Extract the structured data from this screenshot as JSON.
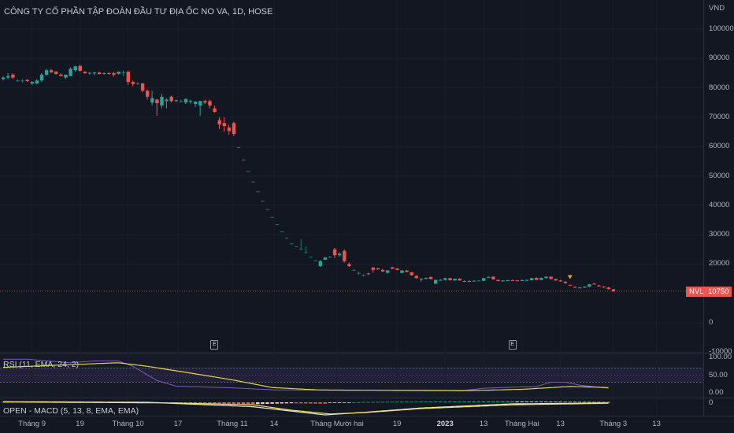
{
  "header": {
    "title": "CÔNG TY CỔ PHẦN TẬP ĐOÀN ĐẦU TƯ ĐỊA ỐC NO VA, 1D, HOSE",
    "currency": "VND"
  },
  "colors": {
    "up": "#26a69a",
    "down": "#ef5350",
    "background": "#131722",
    "rsi": "#7e57c2",
    "rsi_ema": "#e0d34a",
    "macd": "#e6e6e6",
    "signal": "#f5e15a",
    "marker": "#f7a21b"
  },
  "price_axis": {
    "ticks": [
      "100000",
      "90000",
      "80000",
      "70000",
      "60000",
      "50000",
      "40000",
      "30000",
      "20000",
      "0",
      "-10000"
    ],
    "tick_values": [
      100000,
      90000,
      80000,
      70000,
      60000,
      50000,
      40000,
      30000,
      20000,
      0,
      -10000
    ]
  },
  "last_price": {
    "symbol": "NVL",
    "value": "10750",
    "numeric": 10750
  },
  "earnings_markers": [
    {
      "label": "E",
      "bar": 44
    },
    {
      "label": "E",
      "bar": 106
    }
  ],
  "signal_marker": {
    "type": "triangle-down",
    "bar": 118
  },
  "chart_data": {
    "type": "candlestick",
    "unit": "thousand VND",
    "ylim": [
      -10000,
      105000
    ],
    "ohlc": [
      [
        83,
        84,
        82.5,
        83.5
      ],
      [
        83.5,
        85,
        83,
        84
      ],
      [
        84.5,
        85,
        83,
        83.5
      ],
      [
        82.5,
        83,
        82,
        82.5
      ],
      [
        82.5,
        83,
        81.8,
        82.5
      ],
      [
        82.7,
        83,
        82,
        82.3
      ],
      [
        81.5,
        82.3,
        81,
        82
      ],
      [
        81.5,
        83,
        81.3,
        82.5
      ],
      [
        82.5,
        85,
        82,
        84.5
      ],
      [
        84.5,
        86.5,
        84,
        86
      ],
      [
        86,
        86.5,
        85,
        85.3
      ],
      [
        85.5,
        85.8,
        84.5,
        84.7
      ],
      [
        84.5,
        85,
        84,
        84
      ],
      [
        83.5,
        84.5,
        83,
        84.5
      ],
      [
        84,
        87,
        84,
        86.5
      ],
      [
        86,
        87.5,
        85.5,
        87.3
      ],
      [
        87.5,
        87.8,
        85.5,
        85.8
      ],
      [
        85.5,
        85.7,
        84.8,
        85
      ],
      [
        85,
        85.3,
        84.5,
        85.1
      ],
      [
        85,
        85.5,
        84.3,
        85.2
      ],
      [
        85.2,
        85.6,
        84.6,
        84.7
      ],
      [
        84.8,
        85.3,
        84.5,
        85
      ],
      [
        85,
        85.5,
        84.5,
        84.8
      ],
      [
        85,
        85.5,
        83.8,
        84.5
      ],
      [
        84.8,
        85.6,
        84.5,
        85.5
      ],
      [
        85.2,
        86,
        84,
        85.2
      ],
      [
        85.5,
        85.8,
        81,
        82
      ],
      [
        82,
        82.5,
        80.5,
        81.3
      ],
      [
        81.5,
        82,
        81,
        81.5
      ],
      [
        81.5,
        81.7,
        78.5,
        79
      ],
      [
        79,
        79.5,
        76,
        77
      ],
      [
        75,
        79,
        74,
        76.5
      ],
      [
        76,
        76.3,
        70.5,
        74.8
      ],
      [
        74,
        78,
        73,
        77
      ],
      [
        75.5,
        76.5,
        73,
        76
      ],
      [
        77,
        77.3,
        75,
        75.5
      ],
      [
        75.5,
        76,
        75.2,
        75.8
      ],
      [
        75.5,
        76,
        75,
        75.5
      ],
      [
        75,
        76.4,
        74.5,
        76.2
      ],
      [
        75.5,
        76,
        74.5,
        75.6
      ],
      [
        74.5,
        75.5,
        73.5,
        75.3
      ],
      [
        74,
        75.6,
        70.5,
        75.5
      ],
      [
        75.5,
        76,
        74.5,
        75
      ],
      [
        75.5,
        76,
        73,
        74
      ],
      [
        73,
        74,
        71.5,
        71.8
      ],
      [
        69,
        70,
        66,
        67.5
      ],
      [
        68,
        70,
        65,
        67
      ],
      [
        66.5,
        67.5,
        64,
        65.3
      ],
      [
        68,
        68.5,
        63.5,
        64.3
      ],
      [
        59.8,
        59.8,
        59.8,
        59.8
      ],
      [
        55.6,
        55.6,
        55.6,
        55.6
      ],
      [
        51.7,
        51.7,
        51.7,
        51.7
      ],
      [
        48.1,
        48.1,
        48.1,
        48.1
      ],
      [
        44.7,
        44.7,
        44.7,
        44.7
      ],
      [
        41.6,
        41.6,
        41.6,
        41.6
      ],
      [
        38.7,
        38.7,
        38.7,
        38.7
      ],
      [
        36,
        36,
        36,
        36
      ],
      [
        33.5,
        33.5,
        33.5,
        33.5
      ],
      [
        31.1,
        31.1,
        31.1,
        31.1
      ],
      [
        29,
        29,
        29,
        29
      ],
      [
        27,
        27,
        27,
        27
      ],
      [
        26,
        26,
        26,
        26
      ],
      [
        25.2,
        28.5,
        25.2,
        25.2
      ],
      [
        24,
        26,
        24,
        24
      ],
      [
        22.5,
        22.5,
        22.5,
        22.5
      ],
      [
        21.3,
        21.3,
        21.3,
        21.3
      ],
      [
        19.3,
        21.3,
        19,
        21
      ],
      [
        21.5,
        22.5,
        21.3,
        22.2
      ],
      [
        22.5,
        22.8,
        22,
        22.5
      ],
      [
        25,
        25.5,
        22,
        23
      ],
      [
        23,
        24,
        22.5,
        23.5
      ],
      [
        24.5,
        25,
        20.5,
        21
      ],
      [
        20,
        20.5,
        19,
        19.3
      ],
      [
        18,
        18.3,
        17.8,
        18
      ],
      [
        17,
        17.5,
        16.3,
        17
      ],
      [
        16.3,
        16.5,
        15.8,
        16.3
      ],
      [
        16.8,
        17,
        16.3,
        16.6
      ],
      [
        18.8,
        19,
        17,
        18
      ],
      [
        18.5,
        18.8,
        18,
        18.2
      ],
      [
        18,
        18.3,
        17.3,
        17.5
      ],
      [
        17,
        18,
        16.8,
        17.8
      ],
      [
        18.9,
        19,
        18.3,
        18.4
      ],
      [
        18.5,
        18.6,
        17.9,
        18
      ],
      [
        17,
        17.9,
        16.9,
        17.8
      ],
      [
        17.8,
        18,
        17.2,
        17.3
      ],
      [
        17.2,
        17.3,
        16.1,
        16.2
      ],
      [
        16,
        16.2,
        15.1,
        15.2
      ],
      [
        14.8,
        15.2,
        14,
        15
      ],
      [
        15,
        15.4,
        14.8,
        15.3
      ],
      [
        15.6,
        15.7,
        14.8,
        14.9
      ],
      [
        13.3,
        14.7,
        13.2,
        14.6
      ],
      [
        14.5,
        14.9,
        14.3,
        14.6
      ],
      [
        14.6,
        15.3,
        14.4,
        15.2
      ],
      [
        15.2,
        15.3,
        14.4,
        14.5
      ],
      [
        14.4,
        15.1,
        14.3,
        15
      ],
      [
        15,
        15.2,
        14.3,
        14.4
      ],
      [
        14.2,
        14.4,
        13.9,
        14
      ],
      [
        14.1,
        14.5,
        13.9,
        14.2
      ],
      [
        14.2,
        14.5,
        14.1,
        14.3
      ],
      [
        14.4,
        14.6,
        14.2,
        14.4
      ],
      [
        14.3,
        15.3,
        14.2,
        15.2
      ],
      [
        15.4,
        15.8,
        15.3,
        15.6
      ],
      [
        15.7,
        15.8,
        14.7,
        14.8
      ],
      [
        14.6,
        14.8,
        14.1,
        14.2
      ],
      [
        14.1,
        14.5,
        14,
        14.4
      ],
      [
        14.4,
        14.6,
        14.3,
        14.5
      ],
      [
        14.5,
        14.7,
        14.3,
        14.4
      ],
      [
        14.4,
        14.6,
        14.2,
        14.3
      ],
      [
        14.4,
        14.8,
        14.2,
        14.5
      ],
      [
        14.4,
        14.7,
        14.2,
        14.6
      ],
      [
        14.5,
        15.3,
        14.4,
        15.2
      ],
      [
        15.3,
        15.5,
        14.5,
        14.6
      ],
      [
        14.6,
        15.4,
        14.5,
        15.3
      ],
      [
        15.2,
        15.8,
        15.1,
        15.7
      ],
      [
        15.7,
        15.8,
        14.8,
        14.9
      ],
      [
        14.9,
        15,
        14.3,
        14.4
      ],
      [
        14.4,
        14.6,
        14,
        14.1
      ],
      [
        14,
        14.1,
        13.4,
        13.5
      ],
      [
        12.9,
        13,
        12.6,
        12.8
      ],
      [
        12.2,
        12.4,
        11.9,
        12.1
      ],
      [
        11.9,
        12.2,
        11.8,
        12
      ],
      [
        12,
        12.4,
        11.9,
        12.3
      ],
      [
        12.3,
        13.2,
        12.2,
        13.1
      ],
      [
        13.3,
        13.6,
        13,
        13.1
      ],
      [
        12.7,
        12.9,
        12.3,
        12.4
      ],
      [
        12.3,
        12.5,
        11.9,
        12.1
      ],
      [
        12,
        12.2,
        11.4,
        11.5
      ],
      [
        11.4,
        11.5,
        10.6,
        10.75
      ]
    ],
    "time_labels": [
      {
        "label": "Tháng 9",
        "bar": 6
      },
      {
        "label": "19",
        "bar": 16
      },
      {
        "label": "Tháng 10",
        "bar": 26
      },
      {
        "label": "17",
        "bar": 36.4
      },
      {
        "label": "Tháng 11",
        "bar": 47.7
      },
      {
        "label": "14",
        "bar": 56.4
      },
      {
        "label": "Tháng Mười hai",
        "bar": 69.5
      },
      {
        "label": "19",
        "bar": 82
      },
      {
        "label": "2023",
        "bar": 92,
        "bold": true
      },
      {
        "label": "13",
        "bar": 100
      },
      {
        "label": "Tháng Hai",
        "bar": 108
      },
      {
        "label": "13",
        "bar": 116
      },
      {
        "label": "Tháng 3",
        "bar": 127
      },
      {
        "label": "13",
        "bar": 136
      }
    ]
  },
  "rsi": {
    "label": "RSI (11, EMA, 24, 2)",
    "ticks": [
      "100.00",
      "50.00",
      "0.00"
    ],
    "tick_values": [
      100,
      50,
      0
    ],
    "bands": [
      70,
      30
    ],
    "rsi_line": [
      [
        0,
        95
      ],
      [
        5,
        95
      ],
      [
        14,
        85
      ],
      [
        19,
        90
      ],
      [
        24,
        90
      ],
      [
        27,
        75
      ],
      [
        32,
        35
      ],
      [
        36,
        19
      ],
      [
        48,
        14
      ],
      [
        57,
        8
      ],
      [
        96,
        7
      ],
      [
        100,
        13
      ],
      [
        111,
        18
      ],
      [
        114,
        30
      ],
      [
        117,
        30
      ],
      [
        120,
        22
      ],
      [
        126,
        13
      ]
    ],
    "ema_line": [
      [
        0,
        72
      ],
      [
        24,
        85
      ],
      [
        30,
        75
      ],
      [
        38,
        58
      ],
      [
        48,
        36
      ],
      [
        56,
        15
      ],
      [
        66,
        8
      ],
      [
        96,
        6
      ],
      [
        108,
        10
      ],
      [
        118,
        18
      ],
      [
        126,
        15
      ]
    ]
  },
  "macd": {
    "label": "OPEN - MACD (5, 13, 8, EMA, EMA)",
    "ticks": [
      "0"
    ],
    "macd_line": [
      [
        0,
        0.2
      ],
      [
        30,
        0
      ],
      [
        52,
        -1.4
      ],
      [
        60,
        -2.8
      ],
      [
        67,
        -4
      ],
      [
        75,
        -3.2
      ],
      [
        87,
        -1.8
      ],
      [
        106,
        -0.5
      ],
      [
        126,
        -0.2
      ]
    ],
    "signal_line": [
      [
        0,
        0.1
      ],
      [
        35,
        -0.2
      ],
      [
        52,
        -0.8
      ],
      [
        60,
        -2.5
      ],
      [
        68,
        -3.7
      ],
      [
        75,
        -3.3
      ],
      [
        87,
        -2
      ],
      [
        106,
        -0.8
      ],
      [
        126,
        -0.3
      ]
    ]
  }
}
